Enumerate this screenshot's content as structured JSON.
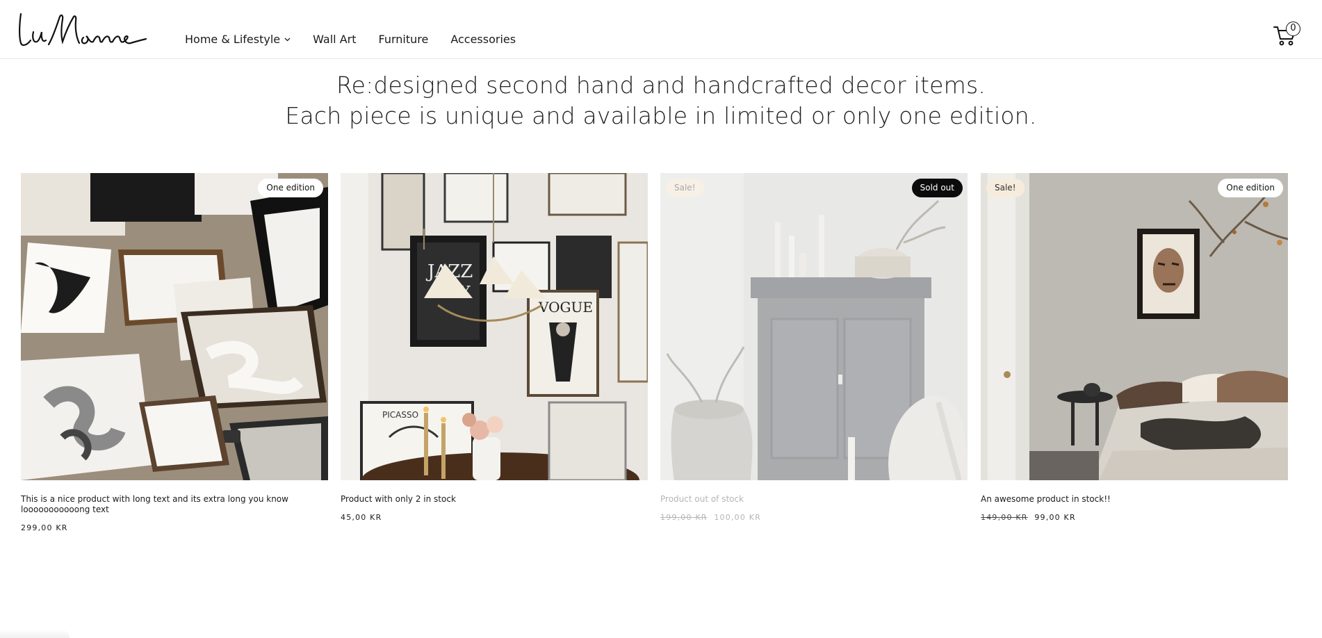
{
  "brand": {
    "logo_text": "La Monne"
  },
  "nav": {
    "items": [
      {
        "label": "Home & Lifestyle",
        "has_dropdown": true
      },
      {
        "label": "Wall Art",
        "has_dropdown": false
      },
      {
        "label": "Furniture",
        "has_dropdown": false
      },
      {
        "label": "Accessories",
        "has_dropdown": false
      }
    ]
  },
  "cart": {
    "count": "0",
    "icon": "cart-icon"
  },
  "hero": {
    "line1": "Re:designed second hand and handcrafted decor items.",
    "line2": "Each piece is unique and available in limited or only one edition."
  },
  "products": [
    {
      "title": "This is a nice product with long text and its extra long you know looooooooooong text",
      "price": "299,00 KR",
      "old_price": "",
      "badge_left": "",
      "badge_right": "One edition",
      "out_of_stock": false
    },
    {
      "title": "Product with only 2 in stock",
      "price": "45,00 KR",
      "old_price": "",
      "badge_left": "",
      "badge_right": "",
      "out_of_stock": false
    },
    {
      "title": "Product out of stock",
      "price": "100,00 KR",
      "old_price": "199,00 KR",
      "badge_left": "Sale!",
      "badge_right": "Sold out",
      "out_of_stock": true
    },
    {
      "title": "An awesome product in stock!!",
      "price": "99,00 KR",
      "old_price": "149,00 KR",
      "badge_left": "Sale!",
      "badge_right": "One edition",
      "out_of_stock": false
    }
  ],
  "colors": {
    "badge_sale_bg": "#f6ecdd",
    "badge_soldout_bg": "#0b0b0b",
    "header_border": "#e6e6e6"
  }
}
